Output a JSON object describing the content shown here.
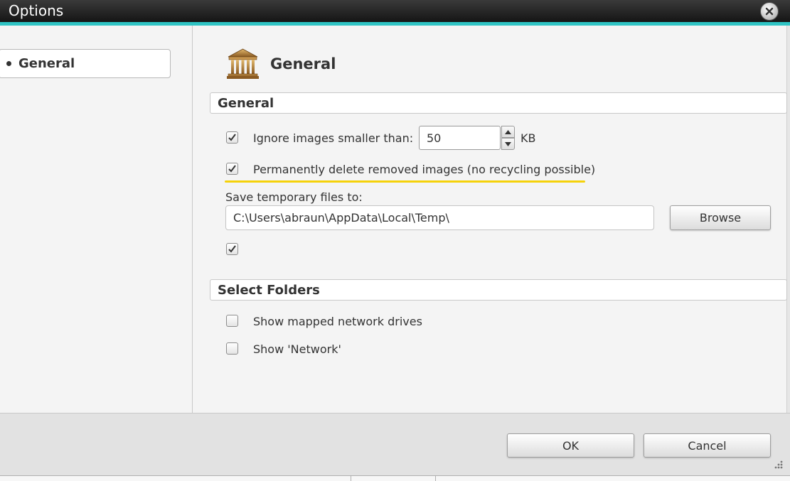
{
  "window": {
    "title": "Options",
    "accent_color": "#2fc4c4"
  },
  "sidebar": {
    "items": [
      {
        "label": "General",
        "selected": true
      }
    ]
  },
  "page": {
    "title": "General",
    "icon": "temple-icon"
  },
  "sections": {
    "general": {
      "title": "General",
      "ignore_small": {
        "checked": true,
        "label": "Ignore images smaller than:",
        "value": "50",
        "unit": "KB"
      },
      "permanent_delete": {
        "checked": true,
        "label": "Permanently delete removed images (no recycling possible)"
      },
      "temp_folder": {
        "label": "Save temporary files to:",
        "path": "C:\\Users\\abraun\\AppData\\Local\\Temp\\",
        "browse_label": "Browse"
      },
      "extra_option": {
        "checked": true
      }
    },
    "select_folders": {
      "title": "Select Folders",
      "show_mapped": {
        "checked": false,
        "label": "Show mapped network drives"
      },
      "show_network": {
        "checked": false,
        "label": "Show 'Network'"
      }
    }
  },
  "footer": {
    "ok_label": "OK",
    "cancel_label": "Cancel"
  }
}
